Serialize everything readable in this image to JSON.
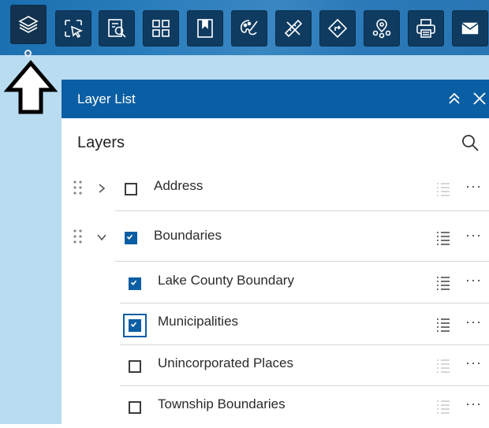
{
  "toolbar": {
    "tools": [
      {
        "icon": "layers-icon",
        "name": "layer-list"
      },
      {
        "icon": "select-icon",
        "name": "select"
      },
      {
        "icon": "query-icon",
        "name": "query"
      },
      {
        "icon": "basemap-gallery-icon",
        "name": "basemap-gallery"
      },
      {
        "icon": "bookmark-icon",
        "name": "bookmarks"
      },
      {
        "icon": "draw-icon",
        "name": "draw"
      },
      {
        "icon": "measure-icon",
        "name": "measure"
      },
      {
        "icon": "directions-icon",
        "name": "directions"
      },
      {
        "icon": "nearby-icon",
        "name": "near-me"
      },
      {
        "icon": "print-icon",
        "name": "print"
      },
      {
        "icon": "mail-icon",
        "name": "share"
      }
    ]
  },
  "panel": {
    "title": "Layer List",
    "section_title": "Layers",
    "layers": [
      {
        "label": "Address",
        "checked": false,
        "expandable": true,
        "expanded": false,
        "legend_enabled": false
      },
      {
        "label": "Boundaries",
        "checked": true,
        "expandable": true,
        "expanded": true,
        "legend_enabled": true
      },
      {
        "label": "Lake County Boundary",
        "checked": true,
        "child": true,
        "legend_enabled": true
      },
      {
        "label": "Municipalities",
        "checked": true,
        "child": true,
        "focused": true,
        "legend_enabled": true
      },
      {
        "label": "Unincorporated Places",
        "checked": false,
        "child": true,
        "legend_enabled": false
      },
      {
        "label": "Township Boundaries",
        "checked": false,
        "child": true,
        "legend_enabled": false
      }
    ],
    "more_label": "···"
  },
  "colors": {
    "header": "#0a5ea3",
    "toolbar_button": "#0f3b61",
    "map_background": "#b9dcf0"
  }
}
